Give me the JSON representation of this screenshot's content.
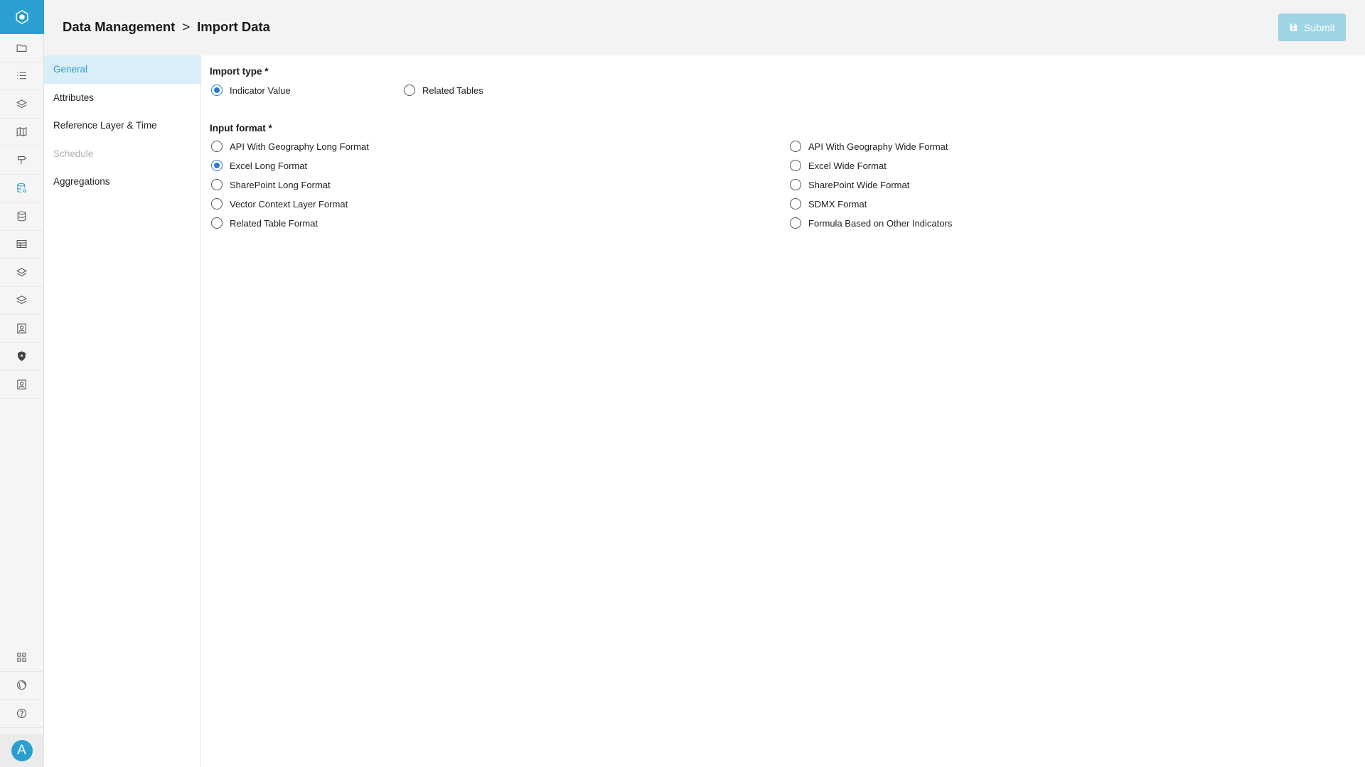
{
  "header": {
    "breadcrumb": [
      "Data Management",
      "Import Data"
    ],
    "separator": ">",
    "submit_label": "Submit"
  },
  "rail": {
    "avatar_initial": "A",
    "items": [
      {
        "icon": "folder-icon"
      },
      {
        "icon": "list-icon"
      },
      {
        "icon": "layers-icon"
      },
      {
        "icon": "map-icon"
      },
      {
        "icon": "signpost-icon"
      },
      {
        "icon": "database-gear-icon",
        "active": true
      },
      {
        "icon": "database-icon"
      },
      {
        "icon": "table-icon"
      },
      {
        "icon": "layers-icon"
      },
      {
        "icon": "layers-icon"
      },
      {
        "icon": "contact-card-icon"
      },
      {
        "icon": "shield-icon"
      },
      {
        "icon": "contact-card-icon"
      }
    ],
    "bottom_items": [
      {
        "icon": "grid-icon"
      },
      {
        "icon": "globe-icon"
      },
      {
        "icon": "help-icon"
      }
    ],
    "accent_color": "#2a9fd0"
  },
  "subnav": {
    "items": [
      {
        "label": "General",
        "state": "active"
      },
      {
        "label": "Attributes",
        "state": "normal"
      },
      {
        "label": "Reference Layer & Time",
        "state": "normal"
      },
      {
        "label": "Schedule",
        "state": "disabled"
      },
      {
        "label": "Aggregations",
        "state": "normal"
      }
    ]
  },
  "form": {
    "import_type": {
      "label": "Import type *",
      "options": [
        {
          "label": "Indicator Value",
          "checked": true
        },
        {
          "label": "Related Tables",
          "checked": false
        }
      ]
    },
    "input_format": {
      "label": "Input format *",
      "left_options": [
        {
          "label": "API With Geography Long Format",
          "checked": false
        },
        {
          "label": "Excel Long Format",
          "checked": true
        },
        {
          "label": "SharePoint Long Format",
          "checked": false
        },
        {
          "label": "Vector Context Layer Format",
          "checked": false
        },
        {
          "label": "Related Table Format",
          "checked": false
        }
      ],
      "right_options": [
        {
          "label": "API With Geography Wide Format",
          "checked": false
        },
        {
          "label": "Excel Wide Format",
          "checked": false
        },
        {
          "label": "SharePoint Wide Format",
          "checked": false
        },
        {
          "label": "SDMX Format",
          "checked": false
        },
        {
          "label": "Formula Based on Other Indicators",
          "checked": false
        }
      ]
    }
  }
}
